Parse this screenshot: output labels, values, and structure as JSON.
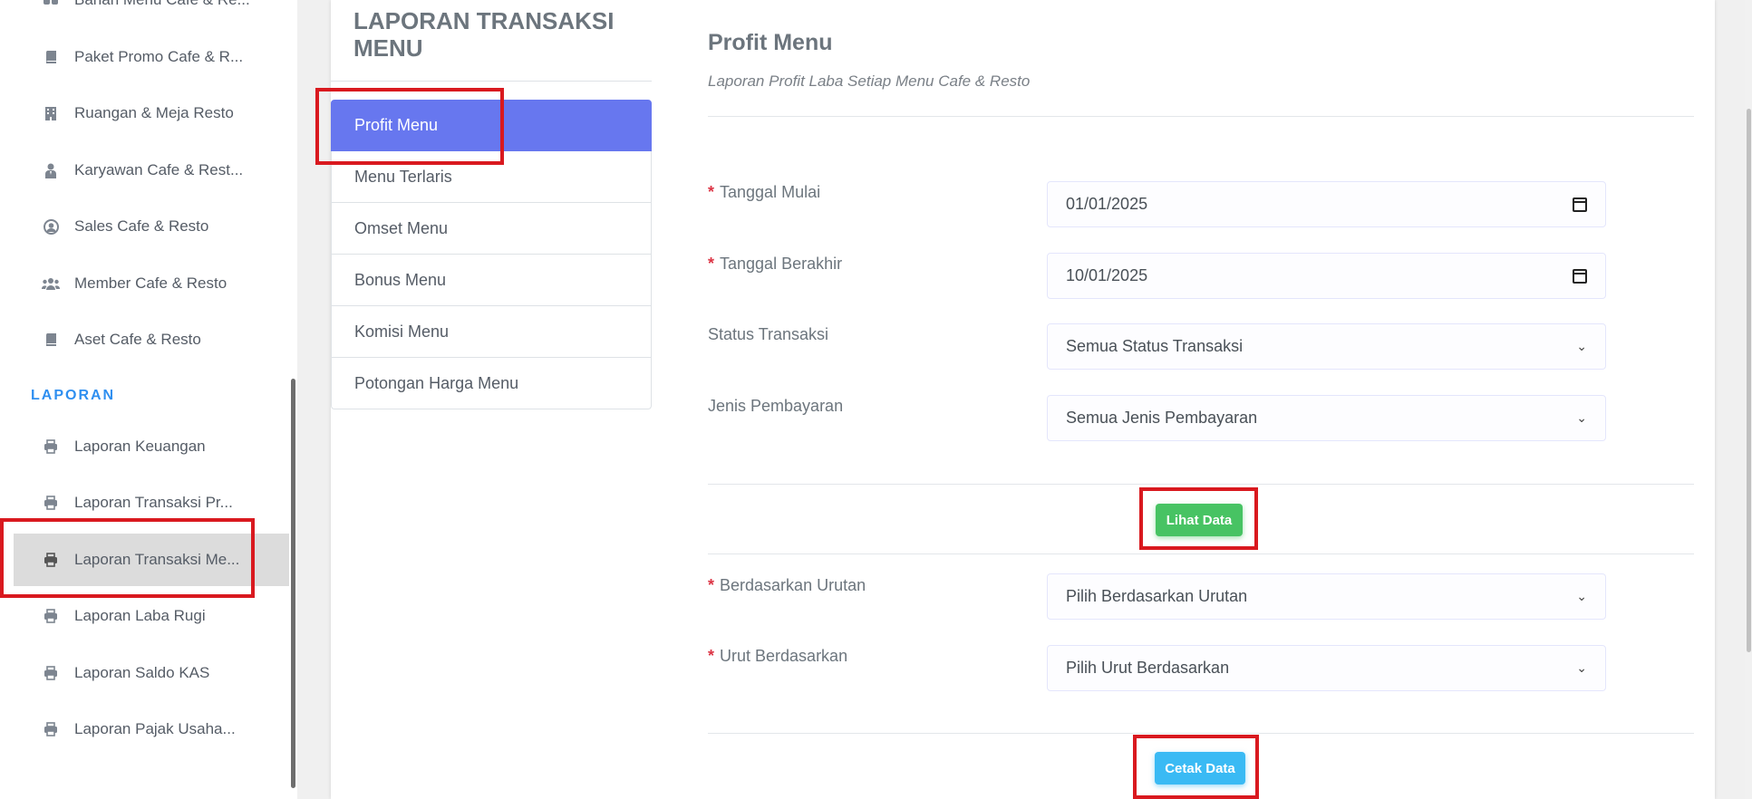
{
  "sidebar": {
    "items_top": [
      {
        "label": "Bahan Menu Cafe & Re...",
        "icon": "utensils-icon"
      },
      {
        "label": "Paket Promo Cafe & R...",
        "icon": "book-icon"
      },
      {
        "label": "Ruangan & Meja Resto",
        "icon": "building-icon"
      },
      {
        "label": "Karyawan Cafe & Rest...",
        "icon": "user-tie-icon"
      },
      {
        "label": "Sales Cafe & Resto",
        "icon": "user-circle-icon"
      },
      {
        "label": "Member Cafe & Resto",
        "icon": "users-icon"
      },
      {
        "label": "Aset Cafe & Resto",
        "icon": "book-icon"
      }
    ],
    "section_title": "LAPORAN",
    "items_report": [
      {
        "label": "Laporan Keuangan",
        "icon": "print-icon"
      },
      {
        "label": "Laporan Transaksi Pr...",
        "icon": "print-icon"
      },
      {
        "label": "Laporan Transaksi Me...",
        "icon": "print-icon",
        "active": true
      },
      {
        "label": "Laporan Laba Rugi",
        "icon": "print-icon"
      },
      {
        "label": "Laporan Saldo KAS",
        "icon": "print-icon"
      },
      {
        "label": "Laporan Pajak Usaha...",
        "icon": "print-icon"
      }
    ]
  },
  "page": {
    "title": "LAPORAN TRANSAKSI MENU"
  },
  "report_menu": [
    {
      "label": "Profit Menu",
      "active": true
    },
    {
      "label": "Menu Terlaris"
    },
    {
      "label": "Omset Menu"
    },
    {
      "label": "Bonus Menu"
    },
    {
      "label": "Komisi Menu"
    },
    {
      "label": "Potongan Harga Menu"
    }
  ],
  "content": {
    "title": "Profit Menu",
    "subtitle": "Laporan Profit Laba Setiap Menu Cafe & Resto"
  },
  "form": {
    "required_mark": "*",
    "tanggal_mulai": {
      "label": "Tanggal Mulai",
      "value": "01/01/2025"
    },
    "tanggal_berakhir": {
      "label": "Tanggal Berakhir",
      "value": "10/01/2025"
    },
    "status_transaksi": {
      "label": "Status Transaksi",
      "value": "Semua Status Transaksi"
    },
    "jenis_pembayaran": {
      "label": "Jenis Pembayaran",
      "value": "Semua Jenis Pembayaran"
    },
    "lihat_button": "Lihat Data",
    "berdasarkan_urutan": {
      "label": "Berdasarkan Urutan",
      "value": "Pilih Berdasarkan Urutan"
    },
    "urut_berdasarkan": {
      "label": "Urut Berdasarkan",
      "value": "Pilih Urut Berdasarkan"
    },
    "cetak_button": "Cetak Data"
  },
  "colors": {
    "primary": "#6777ef",
    "success": "#47c363",
    "info": "#3abaf4",
    "danger": "#dc3545",
    "section": "#2f8ff0",
    "highlight": "#d9191f"
  }
}
